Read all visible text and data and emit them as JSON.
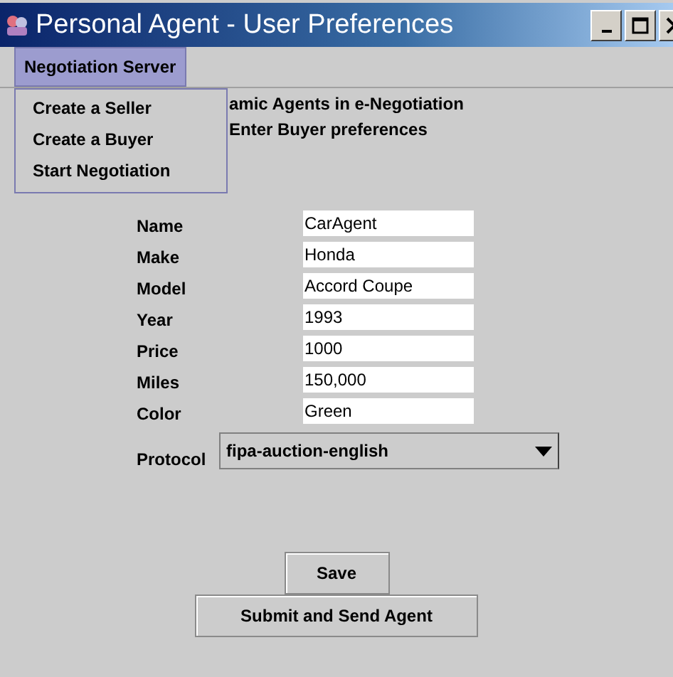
{
  "window": {
    "title": "Personal Agent - User Preferences"
  },
  "menu_bar": [
    {
      "label": "Negotiation Server",
      "selected": true
    }
  ],
  "open_menu": {
    "items": [
      "Create a Seller",
      "Create a Buyer",
      "Start Negotiation"
    ]
  },
  "heading_lines": [
    "amic Agents in e-Negotiation",
    "Enter Buyer preferences"
  ],
  "fields": [
    {
      "label": "Name",
      "value": "CarAgent"
    },
    {
      "label": "Make",
      "value": "Honda"
    },
    {
      "label": "Model",
      "value": "Accord Coupe"
    },
    {
      "label": "Year",
      "value": "1993"
    },
    {
      "label": "Price",
      "value": "1000"
    },
    {
      "label": "Miles",
      "value": "150,000"
    },
    {
      "label": "Color",
      "value": "Green"
    }
  ],
  "protocol": {
    "label": "Protocol",
    "value": "fipa-auction-english"
  },
  "buttons": [
    "Save",
    "Submit and Send Agent"
  ]
}
